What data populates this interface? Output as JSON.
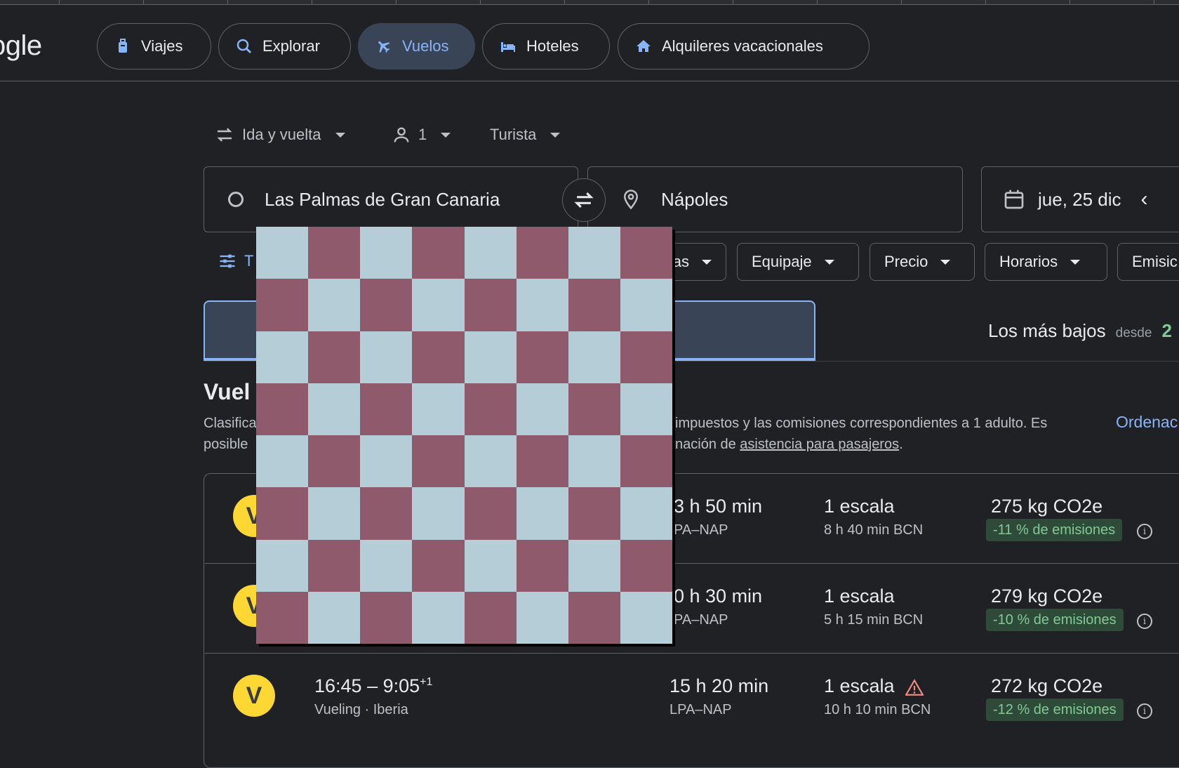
{
  "header": {
    "logo_text": "ogle",
    "nav": [
      {
        "label": "Viajes",
        "icon": "luggage-icon"
      },
      {
        "label": "Explorar",
        "icon": "explore-icon"
      },
      {
        "label": "Vuelos",
        "icon": "flight-icon",
        "active": true
      },
      {
        "label": "Hoteles",
        "icon": "hotel-icon"
      },
      {
        "label": "Alquileres vacacionales",
        "icon": "house-icon"
      }
    ]
  },
  "trip_options": {
    "trip_type": "Ida y vuelta",
    "passengers": "1",
    "cabin_class": "Turista"
  },
  "search": {
    "origin": "Las Palmas de Gran Canaria",
    "destination": "Nápoles",
    "date": "jue, 25 dic"
  },
  "filters": {
    "all_filters_label": "T",
    "chips": [
      "as",
      "Equipaje",
      "Precio",
      "Horarios",
      "Emisic"
    ]
  },
  "tabs": {
    "cheapest_label": "Los más bajos",
    "cheapest_prefix": "desde",
    "cheapest_price_partial": "2"
  },
  "results": {
    "heading": "Vuel",
    "subtext_line1_start": "Clasifica",
    "subtext_line1_end": "impuestos y las comisiones correspondientes a 1 adulto. Es",
    "subtext_line2_start": "posible",
    "subtext_line2_mid": "nación de ",
    "subtext_link": "asistencia para pasajeros",
    "subtext_end": ".",
    "sort_label": "Ordenac",
    "flights": [
      {
        "times": "",
        "airlines": "",
        "duration": "3 h 50 min",
        "route": "PA–NAP",
        "stops": "1 escala",
        "layover": "8 h 40 min BCN",
        "emissions": "275 kg CO2e",
        "emissions_badge": "-11 % de emisiones"
      },
      {
        "times": "",
        "airlines": "",
        "duration": "0 h 30 min",
        "route": "PA–NAP",
        "stops": "1 escala",
        "layover": "5 h 15 min BCN",
        "emissions": "279 kg CO2e",
        "emissions_badge": "-10 % de emisiones"
      },
      {
        "times": "16:45 – 9:05",
        "times_sup": "+1",
        "airlines": "Vueling · Iberia",
        "duration": "15 h 20 min",
        "route": "LPA–NAP",
        "stops": "1 escala",
        "layover": "10 h 10 min BCN",
        "emissions": "272 kg CO2e",
        "emissions_badge": "-12 % de emisiones"
      }
    ]
  },
  "colors": {
    "background": "#202124",
    "accent": "#8ab4f8",
    "active_tab_bg": "#394457",
    "badge_green": "#81c995",
    "checker_light": "#b5cdd6",
    "checker_dark": "#8f5b6c"
  }
}
